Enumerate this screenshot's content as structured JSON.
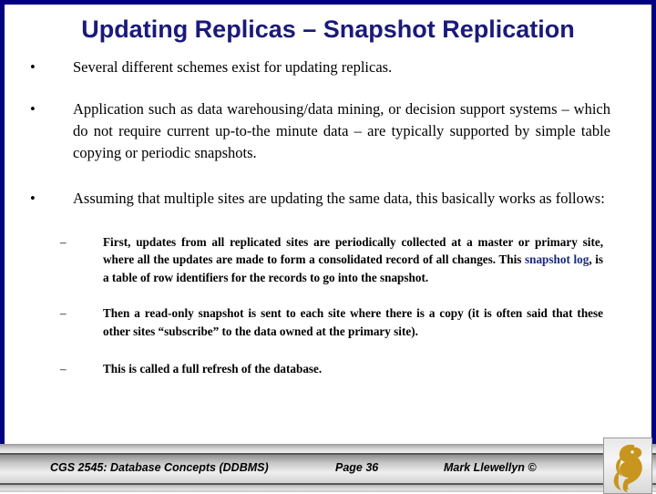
{
  "slide": {
    "title": "Updating Replicas – Snapshot Replication",
    "bullet_marker": "•",
    "sub_marker": "–",
    "bullets": [
      {
        "text": "Several different schemes exist for updating replicas."
      },
      {
        "text": "Application such as data warehousing/data mining, or decision support systems – which do not require current up-to-the minute data – are typically supported by simple table copying or periodic snapshots."
      },
      {
        "text": "Assuming that multiple sites are updating the same data, this basically works as follows:"
      }
    ],
    "sub_bullets": [
      {
        "part_1": "First, updates from all replicated sites are periodically collected at a master or primary site, where all the updates are made to form a consolidated record of all changes.  This ",
        "highlight": "snapshot log",
        "part_2": ", is a table of row identifiers for the records to go into the snapshot."
      },
      {
        "text": "Then a read-only snapshot is sent to each site where there is a copy (it is often said that these other sites “subscribe” to the data owned at the primary site)."
      },
      {
        "text": "This is called a full refresh of the database."
      }
    ]
  },
  "footer": {
    "course": "CGS 2545: Database Concepts  (DDBMS)",
    "page": "Page 36",
    "author": "Mark Llewellyn ©",
    "logo_name": "ucf-pegasus-logo"
  },
  "colors": {
    "frame": "#000080",
    "title": "#1a1a7a",
    "highlight": "#1a2a7a",
    "logo_gold": "#c8951e"
  }
}
